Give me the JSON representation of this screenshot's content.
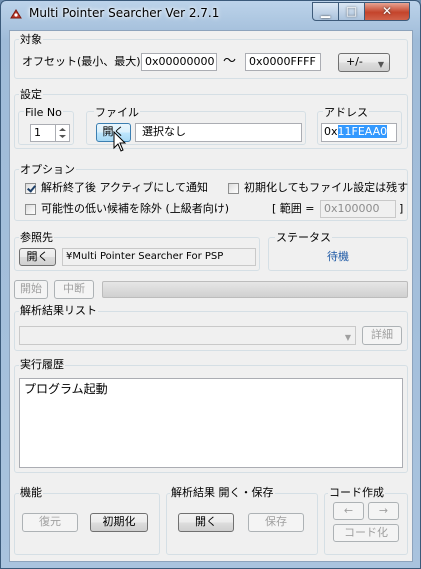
{
  "window": {
    "title": "Multi Pointer Searcher Ver 2.7.1"
  },
  "target": {
    "group_label": "対象",
    "offset_label": "オフセット(最小、最大)",
    "offset_min": "0x00000000",
    "tilde": "〜",
    "offset_max": "0x0000FFFF",
    "plusminus_label": "+/-"
  },
  "settings": {
    "group_label": "設定",
    "fileno_label": "File No",
    "fileno_value": "1",
    "file_label": "ファイル",
    "open_label": "開く",
    "file_value": "選択なし",
    "address_label": "アドレス",
    "address_prefix": "0x",
    "address_selected": "11FEAA0"
  },
  "options": {
    "group_label": "オプション",
    "notify_label": "解析終了後 アクティブにして通知",
    "notify_checked": true,
    "keep_label": "初期化してもファイル設定は残す",
    "keep_checked": false,
    "exclude_label": "可能性の低い候補を除外 (上級者向け)",
    "exclude_checked": false,
    "range_prefix": "[ 範囲 =",
    "range_value": "0x100000",
    "range_suffix": "]"
  },
  "reference": {
    "group_label": "参照先",
    "open_label": "開く",
    "path": "¥Multi Pointer Searcher For PSP"
  },
  "status": {
    "group_label": "ステータス",
    "value": "待機"
  },
  "run": {
    "start_label": "開始",
    "stop_label": "中断",
    "progress": 0
  },
  "results": {
    "group_label": "解析結果リスト",
    "details_label": "詳細"
  },
  "history": {
    "group_label": "実行履歴",
    "lines": [
      "プログラム起動"
    ]
  },
  "functions": {
    "group_label": "機能",
    "restore_label": "復元",
    "init_label": "初期化"
  },
  "resultfile": {
    "group_label": "解析結果 開く・保存",
    "open_label": "開く",
    "save_label": "保存"
  },
  "code": {
    "group_label": "コード作成",
    "left_arrow": "←",
    "right_arrow": "→",
    "codify_label": "コード化"
  }
}
